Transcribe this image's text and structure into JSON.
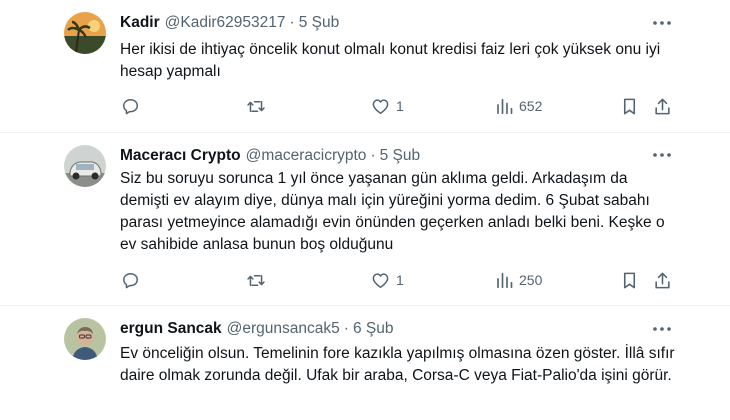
{
  "tweets": [
    {
      "name": "Kadir",
      "handle": "@Kadir62953217",
      "dot": "·",
      "date": "5 Şub",
      "text": "Her ikisi de ihtiyaç öncelik konut olmalı konut kredisi faiz leri çok yüksek onu iyi hesap yapmalı",
      "replies": "",
      "retweets": "",
      "likes": "1",
      "views": "652"
    },
    {
      "name": "Maceracı Crypto",
      "handle": "@maceracicrypto",
      "dot": "·",
      "date": "5 Şub",
      "text": "Siz bu soruyu sorunca 1 yıl önce yaşanan gün aklıma geldi. Arkadaşım da demişti ev alayım diye, dünya malı için yüreğini yorma dedim. 6 Şubat sabahı parası yetmeyince alamadığı evin önünden geçerken anladı belki beni. Keşke o ev sahibide anlasa bunun boş olduğunu",
      "replies": "",
      "retweets": "",
      "likes": "1",
      "views": "250"
    },
    {
      "name": "ergun Sancak",
      "handle": "@ergunsancak5",
      "dot": "·",
      "date": "6 Şub",
      "text": "Ev önceliğin olsun. Temelinin fore kazıkla yapılmış olmasına özen göster. İllâ sıfır daire olmak zorunda değil. Ufak bir araba, Corsa-C veya Fiat-Palio'da işini görür."
    }
  ],
  "colors": {
    "text": "#0f1419",
    "secondary": "#536471",
    "divider": "#eff3f4"
  },
  "icons": [
    "more-icon",
    "reply-icon",
    "retweet-icon",
    "like-icon",
    "views-icon",
    "bookmark-icon",
    "share-icon"
  ]
}
